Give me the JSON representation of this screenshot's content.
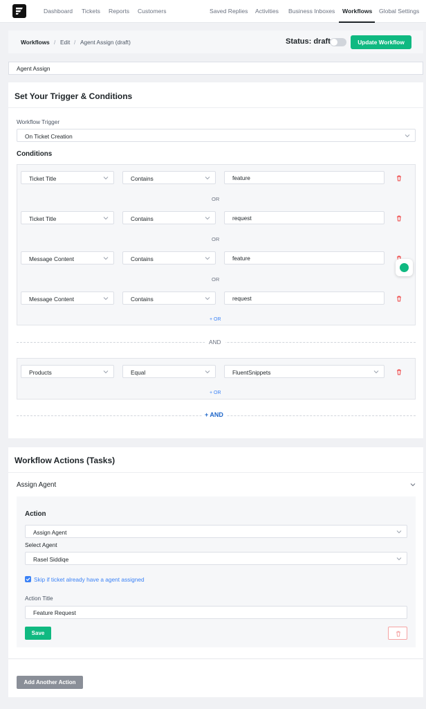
{
  "nav": {
    "left": [
      "Dashboard",
      "Tickets",
      "Reports",
      "Customers"
    ],
    "right": [
      "Saved Replies",
      "Activities",
      "Business Inboxes",
      "Workflows",
      "Global Settings"
    ],
    "active": "Workflows"
  },
  "breadcrumb": [
    "Workflows",
    "Edit",
    "Agent Assign (draft)"
  ],
  "status": {
    "label": "Status: draft",
    "enabled": false
  },
  "update_button": "Update Workflow",
  "workflow_title": "Agent Assign",
  "trigger_section": {
    "title": "Set Your Trigger & Conditions",
    "trigger_label": "Workflow Trigger",
    "trigger_value": "On Ticket Creation",
    "conditions_label": "Conditions",
    "groups": [
      {
        "rows": [
          {
            "field": "Ticket Title",
            "operator": "Contains",
            "value": "feature"
          },
          {
            "field": "Ticket Title",
            "operator": "Contains",
            "value": "request"
          },
          {
            "field": "Message Content",
            "operator": "Contains",
            "value": "feature"
          },
          {
            "field": "Message Content",
            "operator": "Contains",
            "value": "request"
          }
        ]
      },
      {
        "rows": [
          {
            "field": "Products",
            "operator": "Equal",
            "value": "FluentSnippets"
          }
        ]
      }
    ],
    "or_text": "OR",
    "add_or": "+ OR",
    "and_text": "AND",
    "add_and": "+ AND"
  },
  "actions_section": {
    "title": "Workflow Actions (Tasks)",
    "action_header": "Assign Agent",
    "action_label": "Action",
    "action_value": "Assign Agent",
    "select_agent_label": "Select Agent",
    "agent_value": "Rasel Siddiqe",
    "skip_label": "Skip if ticket already have a agent assigned",
    "skip_checked": true,
    "action_title_label": "Action Title",
    "action_title_value": "Feature Request",
    "save_button": "Save",
    "add_another_button": "Add Another Action"
  },
  "colors": {
    "accent_green": "#10b981",
    "link_blue": "#3b82f6",
    "danger_red": "#ef4444"
  }
}
